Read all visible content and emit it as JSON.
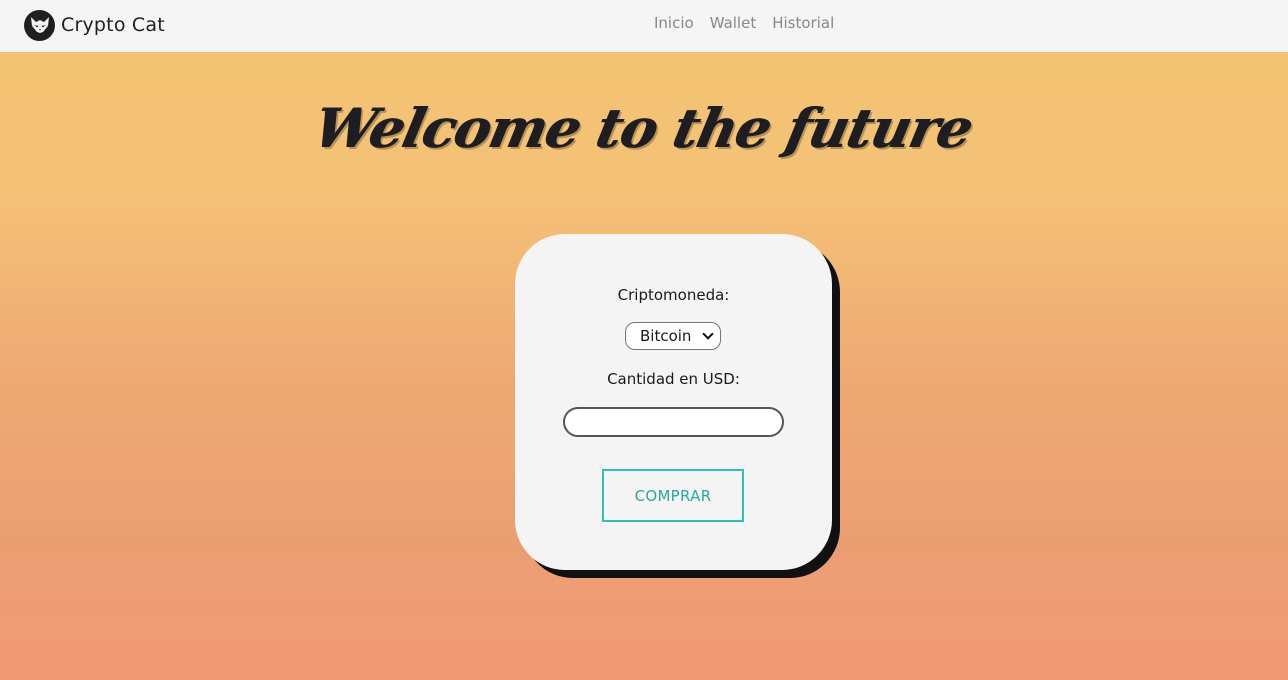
{
  "navbar": {
    "brand_name": "Crypto Cat",
    "brand_logo_icon": "cat-logo-icon",
    "links": [
      {
        "label": "Inicio"
      },
      {
        "label": "Wallet"
      },
      {
        "label": "Historial"
      }
    ]
  },
  "hero": {
    "title": "Welcome to the future"
  },
  "purchase_form": {
    "crypto_label": "Criptomoneda:",
    "crypto_selected": "Bitcoin",
    "amount_label": "Cantidad en USD:",
    "amount_value": "",
    "amount_placeholder": "",
    "buy_label": "COMPRAR"
  },
  "colors": {
    "accent": "#2fbfb3",
    "gradient_top": "#f1c46f",
    "gradient_bottom": "#f29a76",
    "card_bg": "#f4f4f4"
  }
}
